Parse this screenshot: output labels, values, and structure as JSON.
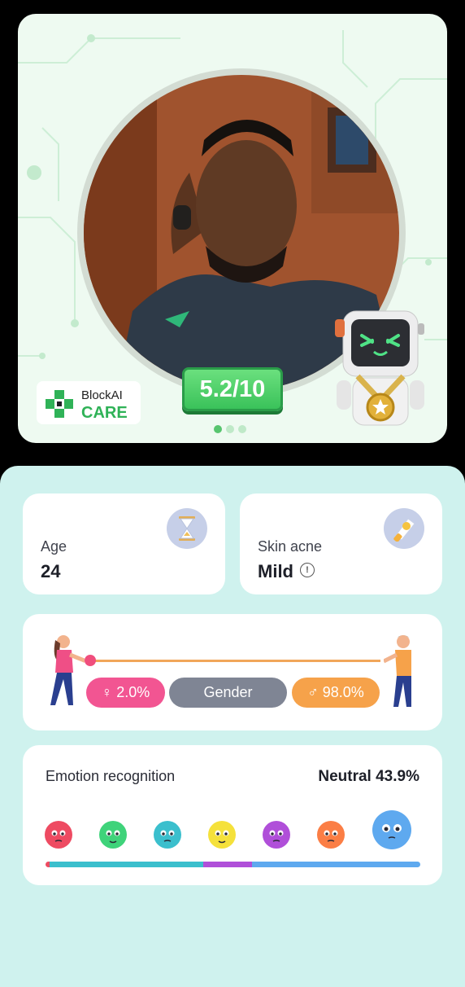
{
  "brand": {
    "line1": "BlockAI",
    "line2": "CARE",
    "accent": "#2fb257"
  },
  "score": {
    "value": "5.2/10"
  },
  "carousel": {
    "pages": 3,
    "active": 0
  },
  "age": {
    "label": "Age",
    "value": "24",
    "icon": "hourglass-icon"
  },
  "acne": {
    "label": "Skin acne",
    "value": "Mild",
    "icon": "sunscreen-tube-icon"
  },
  "gender": {
    "label": "Gender",
    "female": "♀ 2.0%",
    "male": "♂ 98.0%",
    "female_fraction": 0.02,
    "male_fraction": 0.98,
    "female_color": "#f25592",
    "male_color": "#f6a24a"
  },
  "emotion": {
    "title": "Emotion recognition",
    "result": "Neutral 43.9%",
    "faces": [
      {
        "icon": "angry-face-icon",
        "color": "#ee4b62"
      },
      {
        "icon": "happy-face-icon",
        "color": "#3fd37a"
      },
      {
        "icon": "sad-face-icon",
        "color": "#3bbfcd"
      },
      {
        "icon": "calm-face-icon",
        "color": "#f5e13b"
      },
      {
        "icon": "surprised-face-icon",
        "color": "#b04fd9"
      },
      {
        "icon": "fear-face-icon",
        "color": "#fb7e45"
      },
      {
        "icon": "neutral-face-icon",
        "color": "#5ea9ef"
      }
    ],
    "bar_segments": [
      {
        "fraction": 0.01,
        "color": "#ee4b62"
      },
      {
        "fraction": 0.41,
        "color": "#3bbfcd"
      },
      {
        "fraction": 0.13,
        "color": "#b04fd9"
      },
      {
        "fraction": 0.45,
        "color": "#5ea9ef"
      }
    ]
  }
}
